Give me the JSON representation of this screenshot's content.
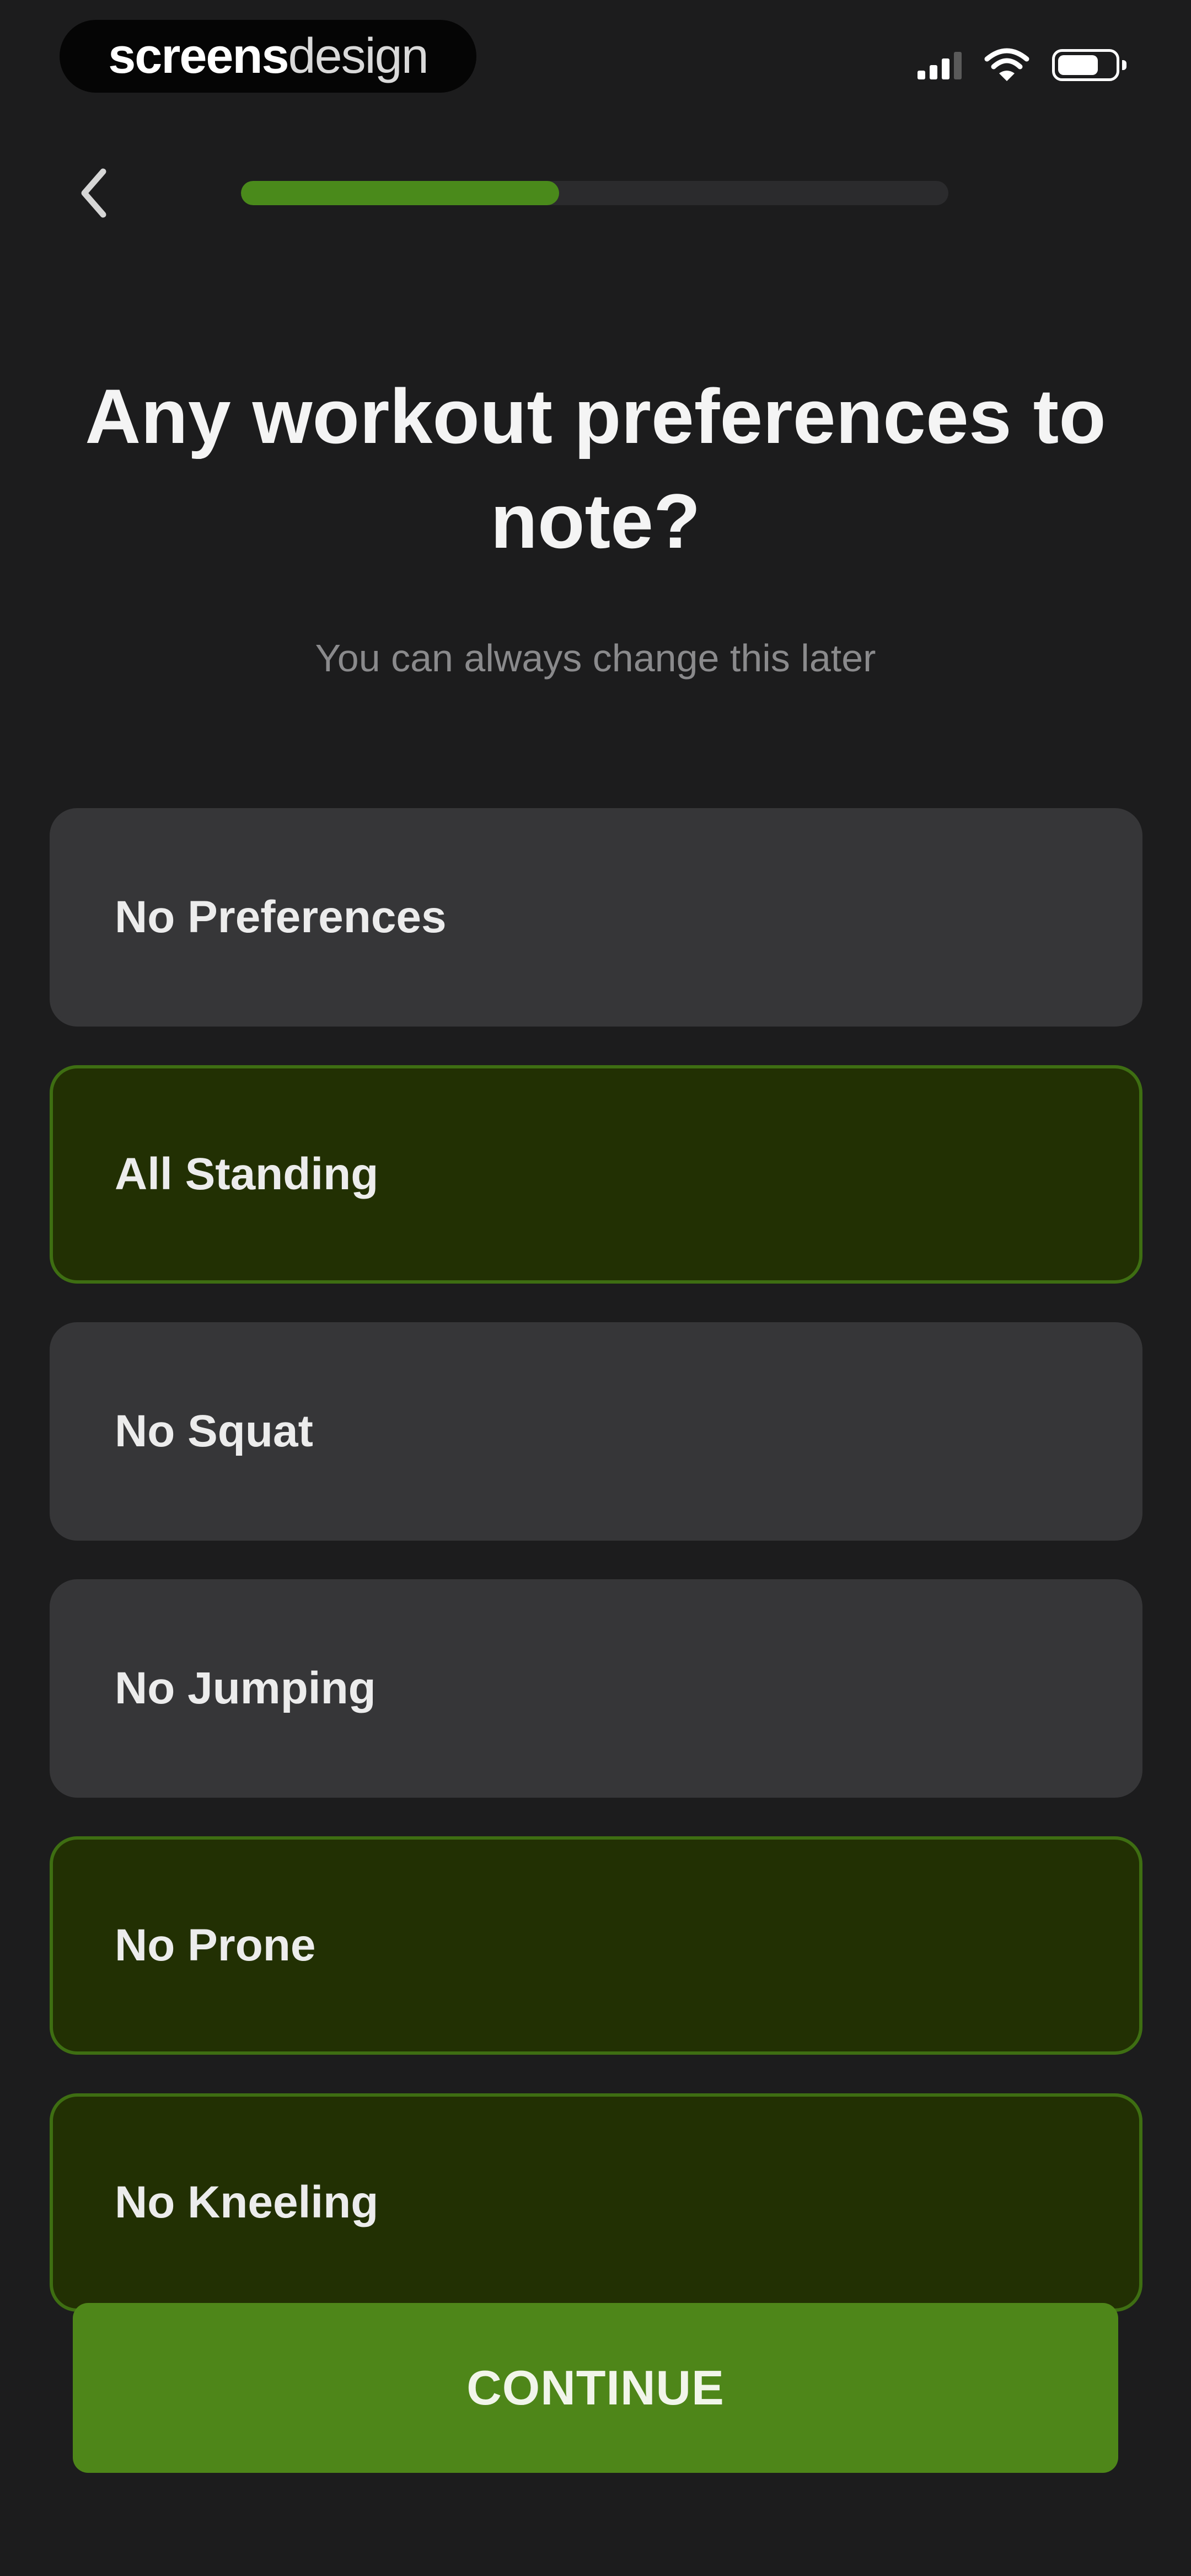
{
  "status_bar": {
    "watermark_part1": "screens",
    "watermark_part2": "design",
    "icons": [
      "signal-icon",
      "wifi-icon",
      "battery-icon"
    ]
  },
  "nav": {
    "back_icon": "chevron-left-icon",
    "progress_fraction": 0.45
  },
  "header": {
    "title": "Any workout preferences to note?",
    "subtitle": "You can always change this later"
  },
  "options": [
    {
      "label": "No Preferences",
      "selected": false
    },
    {
      "label": "All Standing",
      "selected": true
    },
    {
      "label": "No Squat",
      "selected": false
    },
    {
      "label": "No Jumping",
      "selected": false
    },
    {
      "label": "No Prone",
      "selected": true
    },
    {
      "label": "No Kneeling",
      "selected": true
    }
  ],
  "actions": {
    "continue_label": "CONTINUE"
  },
  "colors": {
    "background": "#1c1c1d",
    "card": "#363638",
    "card_selected": "#223003",
    "card_selected_border": "#3e6e12",
    "accent": "#4e8619"
  }
}
